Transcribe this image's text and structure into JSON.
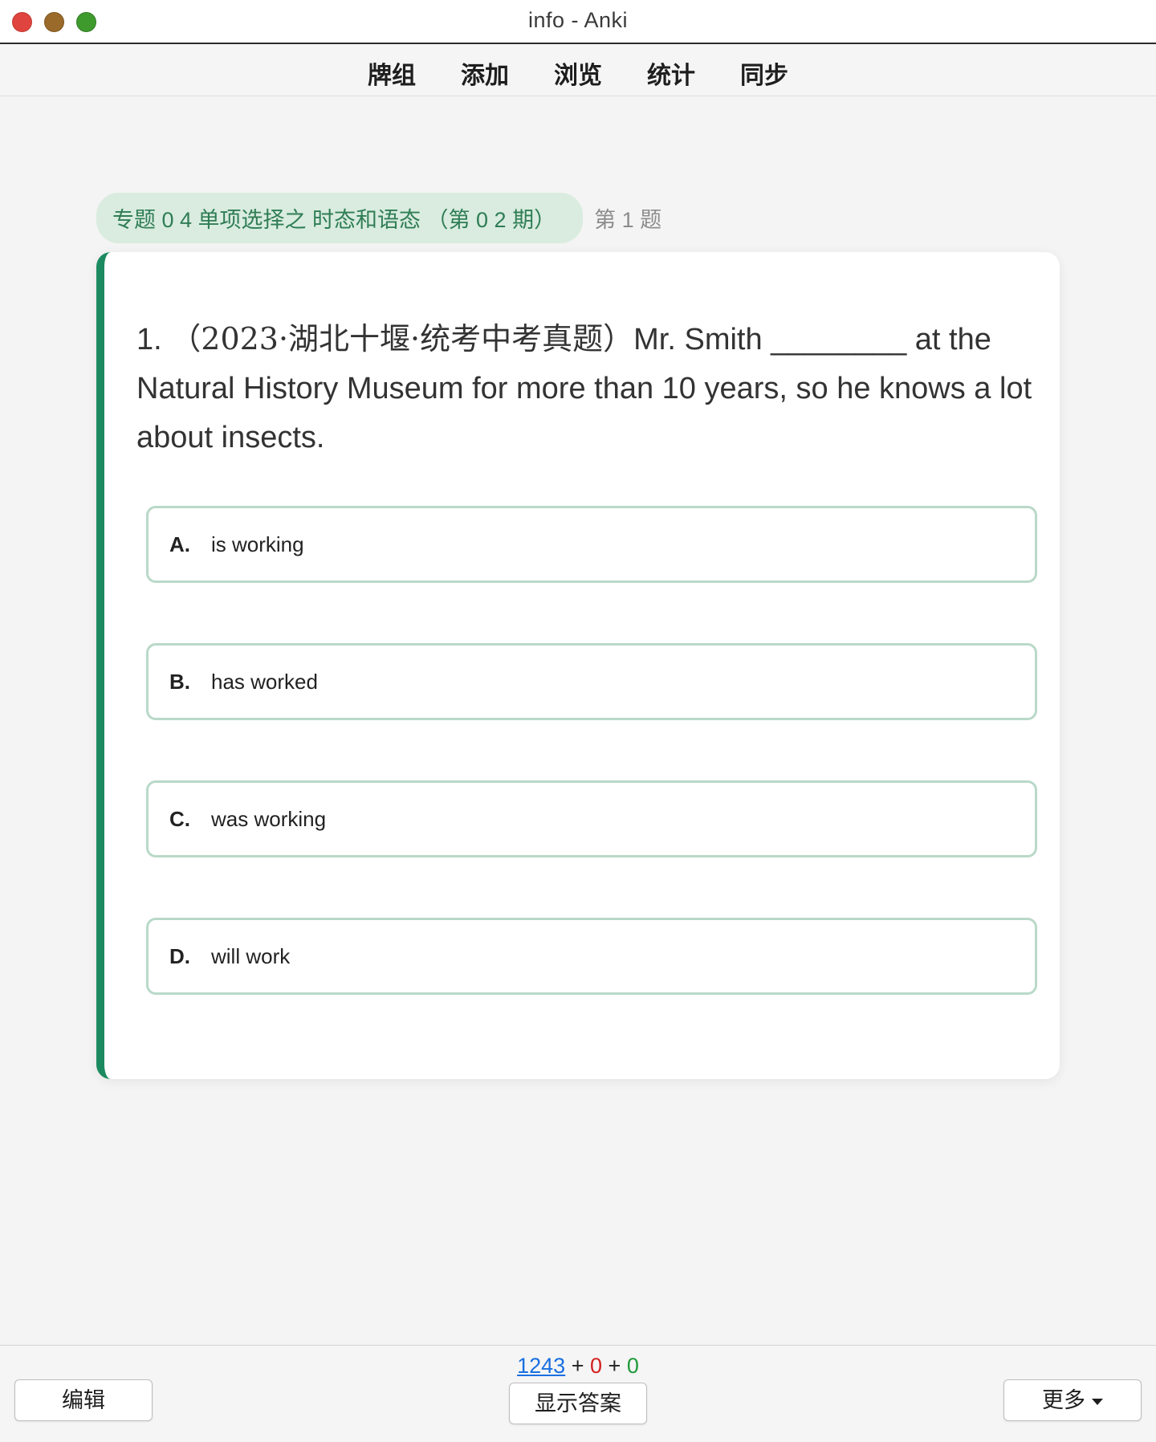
{
  "window": {
    "title": "info - Anki"
  },
  "menu": {
    "items": [
      {
        "label": "牌组"
      },
      {
        "label": "添加"
      },
      {
        "label": "浏览"
      },
      {
        "label": "统计"
      },
      {
        "label": "同步"
      }
    ]
  },
  "card": {
    "deck_tag": "专题 0 4 单项选择之 时态和语态 （第 0 2 期）",
    "question_number_label": "第 1 题",
    "question": {
      "number": "1.",
      "source": "（2023·湖北十堰·统考中考真题）",
      "text": "Mr. Smith ________ at the Natural History Museum for more than 10 years, so he knows a lot about insects."
    },
    "options": [
      {
        "letter": "A.",
        "text": "is working"
      },
      {
        "letter": "B.",
        "text": "has worked"
      },
      {
        "letter": "C.",
        "text": "was working"
      },
      {
        "letter": "D.",
        "text": "will work"
      }
    ],
    "accent_color": "#1c8a60"
  },
  "bottom": {
    "counts": {
      "new": "1243",
      "learning": "0",
      "review": "0",
      "separator": "+"
    },
    "edit_label": "编辑",
    "show_answer_label": "显示答案",
    "more_label": "更多"
  }
}
